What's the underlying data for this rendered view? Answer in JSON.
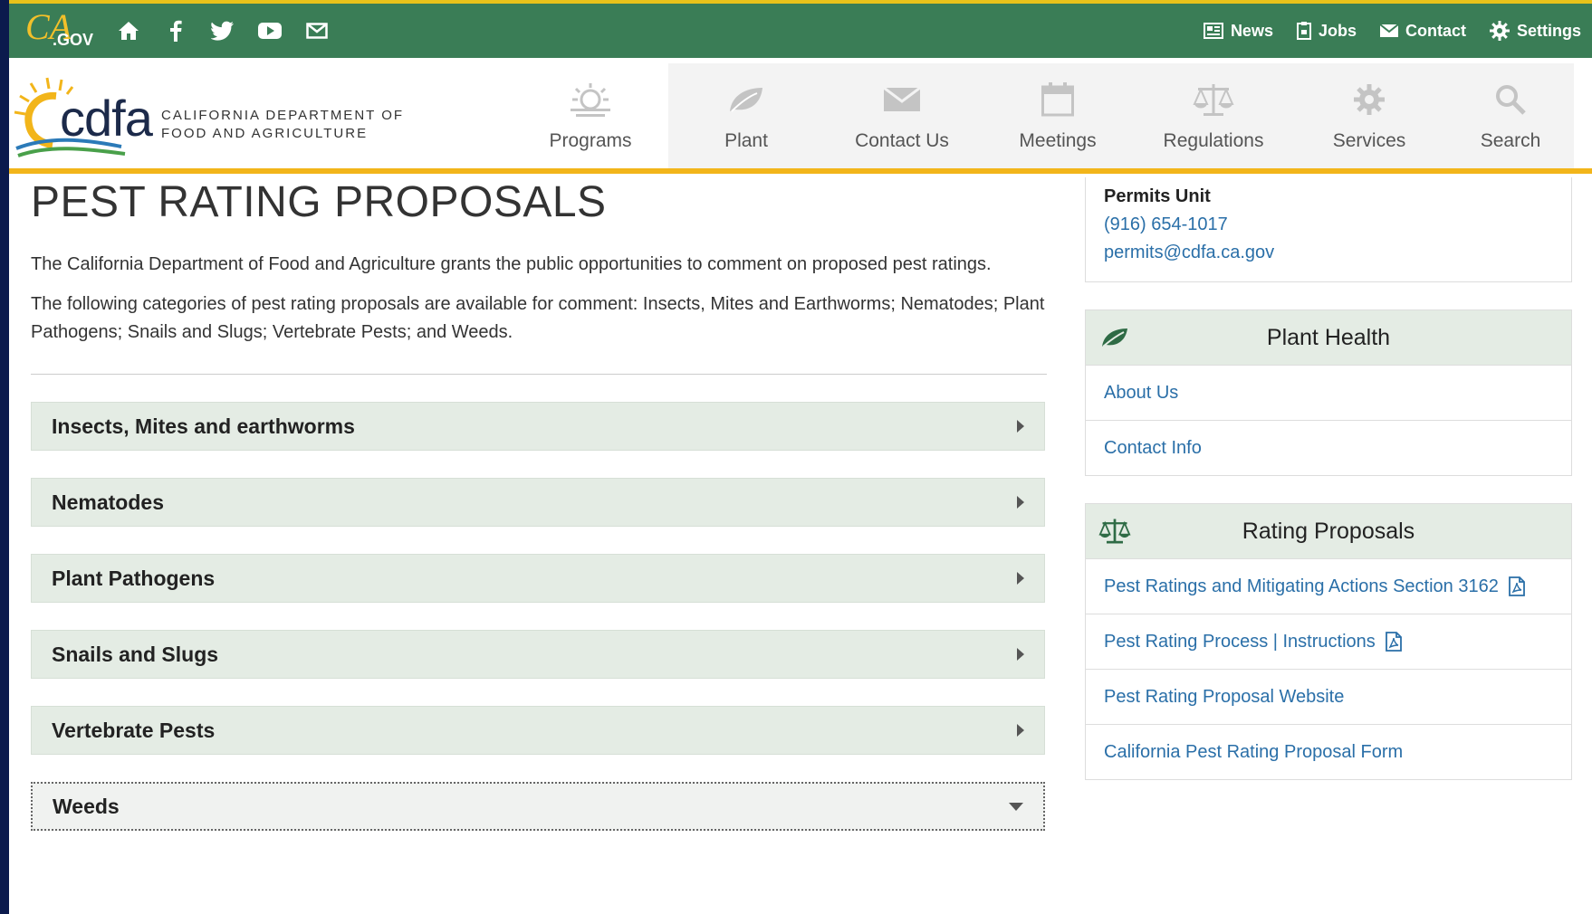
{
  "utility": {
    "logo_ca": "CA",
    "logo_gov": ".GOV",
    "icons": [
      "home-icon",
      "facebook-icon",
      "twitter-icon",
      "youtube-icon",
      "email-icon"
    ],
    "links": [
      {
        "label": "News",
        "icon": "newspaper-icon"
      },
      {
        "label": "Jobs",
        "icon": "clipboard-icon"
      },
      {
        "label": "Contact",
        "icon": "envelope-icon"
      },
      {
        "label": "Settings",
        "icon": "gear-icon"
      }
    ],
    "bg_color": "#3a7d56"
  },
  "header": {
    "logo_text": "cdfa",
    "dept_line1": "CALIFORNIA DEPARTMENT OF",
    "dept_line2": "FOOD AND AGRICULTURE",
    "accent_color": "#f2b51a",
    "nav": [
      {
        "label": "Programs",
        "icon": "sun-icon"
      },
      {
        "label": "Plant",
        "icon": "leaf-icon"
      },
      {
        "label": "Contact Us",
        "icon": "envelope-icon"
      },
      {
        "label": "Meetings",
        "icon": "calendar-icon"
      },
      {
        "label": "Regulations",
        "icon": "scales-icon"
      },
      {
        "label": "Services",
        "icon": "gear-icon"
      },
      {
        "label": "Search",
        "icon": "search-icon"
      }
    ]
  },
  "main": {
    "title": "PEST RATING PROPOSALS",
    "intro": "The California Department of Food and Agriculture grants the public opportunities to comment on proposed pest ratings.",
    "categories_text": "The following categories of pest rating proposals are available for comment: Insects, Mites and Earthworms; Nematodes; Plant Pathogens; Snails and Slugs; Vertebrate Pests; and Weeds.",
    "accordion": [
      {
        "label": "Insects, Mites and earthworms",
        "open": false
      },
      {
        "label": "Nematodes",
        "open": false
      },
      {
        "label": "Plant Pathogens",
        "open": false
      },
      {
        "label": "Snails and Slugs",
        "open": false
      },
      {
        "label": "Vertebrate Pests",
        "open": false
      },
      {
        "label": "Weeds",
        "open": true
      }
    ]
  },
  "sidebar": {
    "contact": {
      "unit": "Permits Unit",
      "phone": "(916) 654-1017",
      "email": "permits@cdfa.ca.gov"
    },
    "plant_health": {
      "title": "Plant Health",
      "icon": "leaf-icon",
      "links": [
        "About Us",
        "Contact Info"
      ]
    },
    "rating_proposals": {
      "title": "Rating Proposals",
      "icon": "scales-icon",
      "links": [
        {
          "label": "Pest Ratings and Mitigating Actions Section 3162",
          "pdf": true
        },
        {
          "label": "Pest Rating Process | Instructions",
          "pdf": true
        },
        {
          "label": "Pest Rating Proposal Website",
          "pdf": false
        },
        {
          "label": "California Pest Rating Proposal Form",
          "pdf": false
        }
      ]
    }
  }
}
